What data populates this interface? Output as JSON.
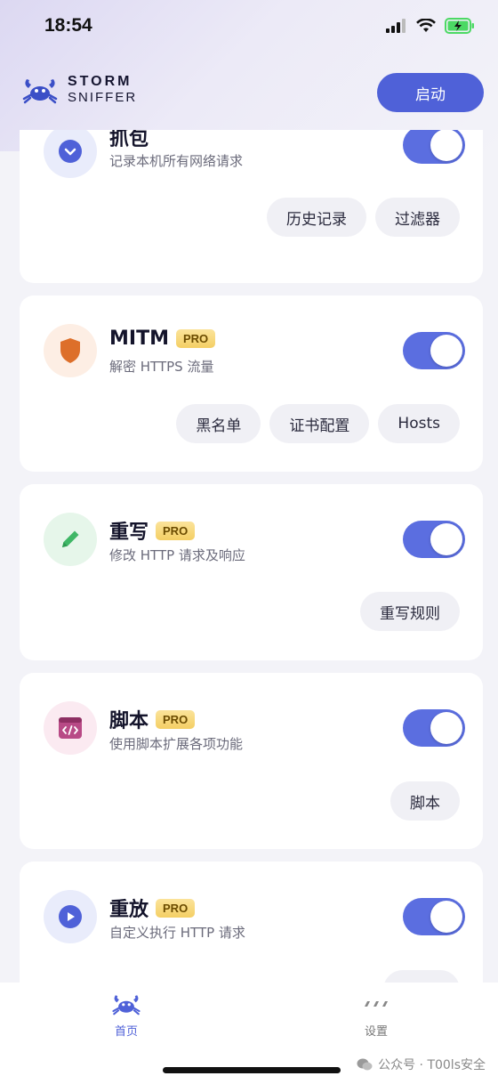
{
  "status": {
    "time": "18:54"
  },
  "brand": {
    "line1": "STORM",
    "line2": "SNIFFER"
  },
  "header": {
    "start_label": "启动"
  },
  "accent_color": "#4f61d8",
  "cards": [
    {
      "title": "抓包",
      "pro": false,
      "subtitle": "记录本机所有网络请求",
      "enabled": true,
      "icon": "chevron-down-icon",
      "buttons": [
        "历史记录",
        "过滤器"
      ]
    },
    {
      "title": "MITM",
      "pro": true,
      "pro_label": "PRO",
      "subtitle": "解密 HTTPS 流量",
      "enabled": true,
      "icon": "shield-icon",
      "buttons": [
        "黑名单",
        "证书配置",
        "Hosts"
      ]
    },
    {
      "title": "重写",
      "pro": true,
      "pro_label": "PRO",
      "subtitle": "修改 HTTP 请求及响应",
      "enabled": true,
      "icon": "pencil-icon",
      "buttons": [
        "重写规则"
      ]
    },
    {
      "title": "脚本",
      "pro": true,
      "pro_label": "PRO",
      "subtitle": "使用脚本扩展各项功能",
      "enabled": true,
      "icon": "code-window-icon",
      "buttons": [
        "脚本"
      ]
    },
    {
      "title": "重放",
      "pro": true,
      "pro_label": "PRO",
      "subtitle": "自定义执行 HTTP 请求",
      "enabled": true,
      "icon": "play-icon",
      "buttons": []
    }
  ],
  "tabs": [
    {
      "label": "首页",
      "active": true,
      "icon": "crab-icon"
    },
    {
      "label": "设置",
      "active": false,
      "icon": "dots-icon"
    }
  ],
  "watermark": "公众号 · T00ls安全"
}
